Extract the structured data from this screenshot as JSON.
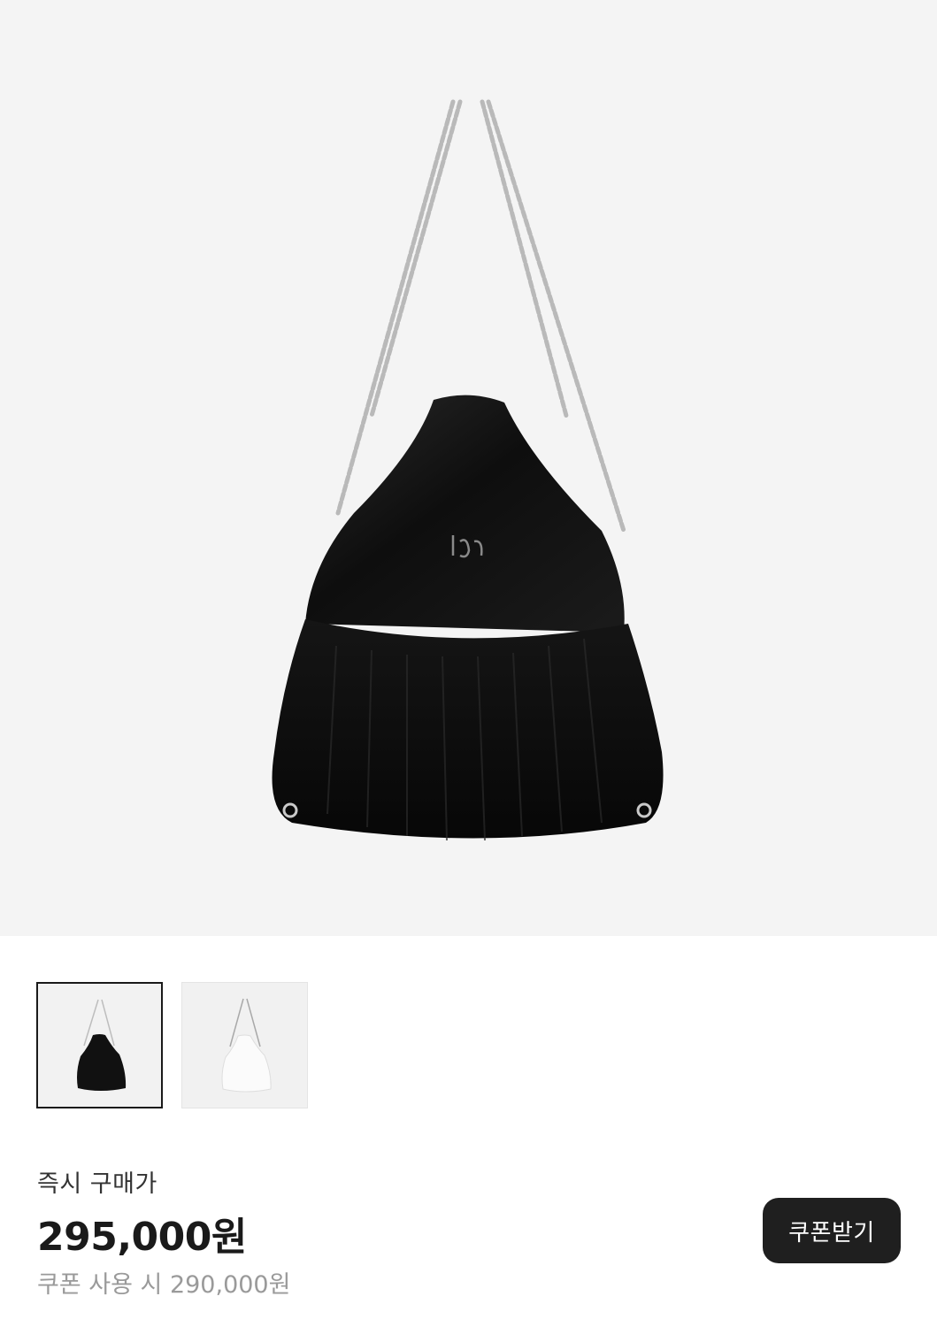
{
  "product": {
    "main_image": "black-velvet-drawstring-chain-bag",
    "thumbnails": [
      {
        "image": "black-velvet-bag-thumbnail",
        "selected": true
      },
      {
        "image": "white-bag-thumbnail",
        "selected": false
      }
    ]
  },
  "pricing": {
    "label": "즉시 구매가",
    "price": "295,000원",
    "coupon_price": "쿠폰 사용 시 290,000원",
    "coupon_button": "쿠폰받기"
  },
  "colors": {
    "hero_background": "#f4f4f4",
    "button_background": "#1f1f1f",
    "secondary_text": "#9a9a9a"
  }
}
